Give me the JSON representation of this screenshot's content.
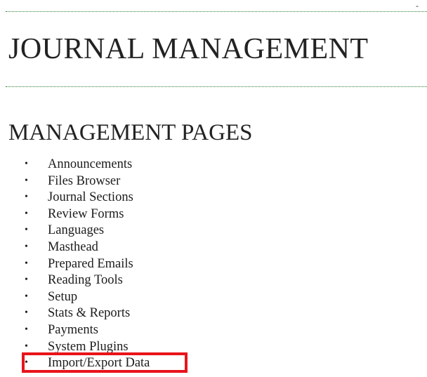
{
  "top_mark": "-",
  "page_title": "JOURNAL MANAGEMENT",
  "section_title": "MANAGEMENT PAGES",
  "bullet_glyph": "•",
  "highlight_color": "#e8141b",
  "rule_color": "#2e7d32",
  "items": [
    "Announcements",
    "Files Browser",
    "Journal Sections",
    "Review Forms",
    "Languages",
    "Masthead",
    "Prepared Emails",
    "Reading Tools",
    "Setup",
    "Stats & Reports",
    "Payments",
    "System Plugins",
    "Import/Export Data"
  ]
}
